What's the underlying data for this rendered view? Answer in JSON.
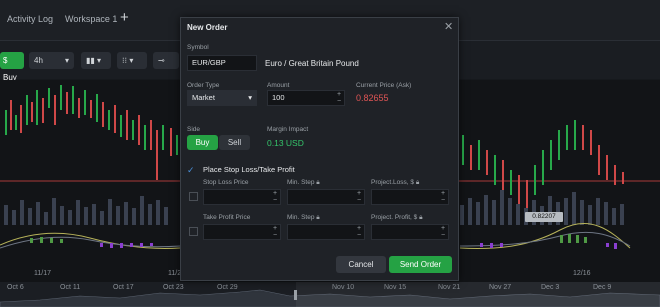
{
  "tabs": {
    "activity_log": "Activity Log",
    "workspace": "Workspace 1",
    "add": "+"
  },
  "toolbar": {
    "buy": "$ Buy",
    "timeframe": "4h",
    "chart_type": "candles",
    "indicators": "indicators",
    "tools": "drawing-tools"
  },
  "chart": {
    "price_tag": "0.82207"
  },
  "time_axis": [
    "11/17",
    "11/2",
    "12/16"
  ],
  "navigator": [
    "Oct 6",
    "Oct 11",
    "Oct 17",
    "Oct 23",
    "Oct 29",
    "Nov 10",
    "Nov 15",
    "Nov 21",
    "Nov 27",
    "Dec 3",
    "Dec 9"
  ],
  "order": {
    "title": "New Order",
    "symbol_label": "Symbol",
    "symbol": "EUR/GBP",
    "symbol_name": "Euro / Great Britain Pound",
    "order_type_label": "Order Type",
    "order_type": "Market",
    "amount_label": "Amount",
    "amount": "100",
    "current_price_label": "Current Price (Ask)",
    "current_price": "0.82655",
    "side_label": "Side",
    "buy": "Buy",
    "sell": "Sell",
    "margin_label": "Margin Impact",
    "margin": "0.13 USD",
    "sltp_label": "Place Stop Loss/Take Profit",
    "stop_loss_price": "Stop Loss Price",
    "min_step": "Min. Step",
    "project_loss": "Project.Loss, $",
    "take_profit_price": "Take Profit Price",
    "min_step2": "Min. Step",
    "project_profit": "Project. Profit, $",
    "cancel": "Cancel",
    "send": "Send Order"
  },
  "colors": {
    "buy_green": "#25a244",
    "price_red": "#e05555",
    "margin_green": "#35c46a"
  }
}
